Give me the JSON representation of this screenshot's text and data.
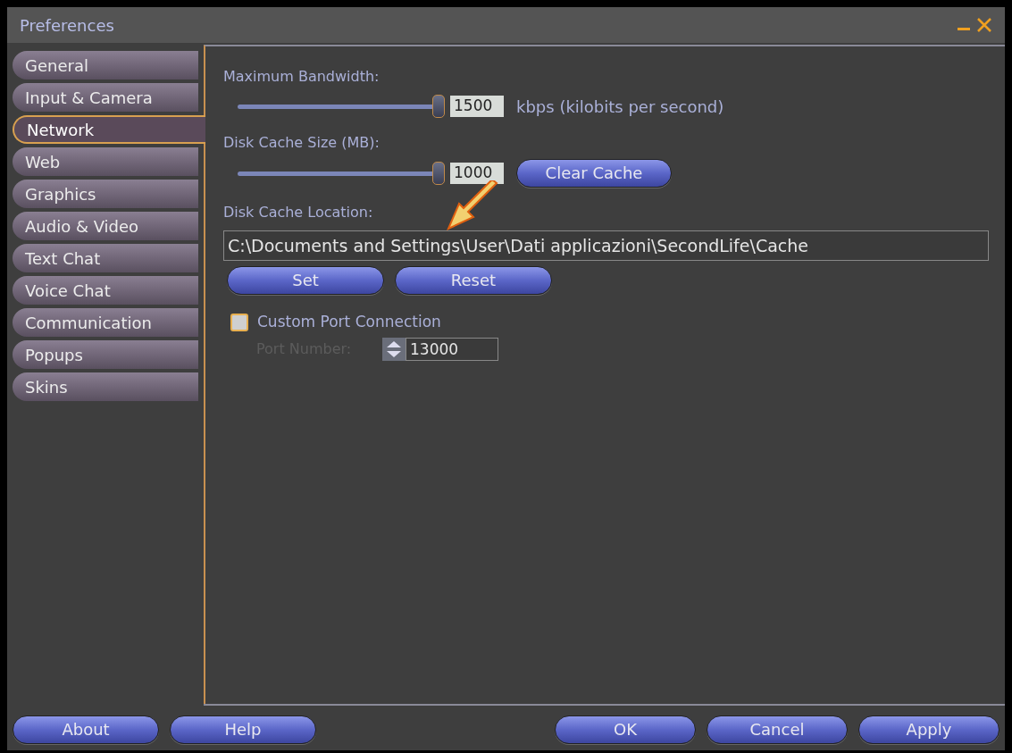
{
  "window": {
    "title": "Preferences"
  },
  "sidebar": {
    "items": [
      {
        "label": "General",
        "selected": false
      },
      {
        "label": "Input & Camera",
        "selected": false
      },
      {
        "label": "Network",
        "selected": true
      },
      {
        "label": "Web",
        "selected": false
      },
      {
        "label": "Graphics",
        "selected": false
      },
      {
        "label": "Audio & Video",
        "selected": false
      },
      {
        "label": "Text Chat",
        "selected": false
      },
      {
        "label": "Voice Chat",
        "selected": false
      },
      {
        "label": "Communication",
        "selected": false
      },
      {
        "label": "Popups",
        "selected": false
      },
      {
        "label": "Skins",
        "selected": false
      }
    ]
  },
  "bandwidth": {
    "label": "Maximum Bandwidth:",
    "level": 1,
    "value": "1500",
    "unit": "kbps (kilobits per second)"
  },
  "disk_cache": {
    "label": "Disk Cache Size (MB):",
    "level": 1,
    "value": "1000",
    "button": "Clear Cache"
  },
  "cache_location": {
    "label": "Disk Cache Location:",
    "value": "C:\\Documents and Settings\\User\\Dati applicazioni\\SecondLife\\Cache",
    "buttons": [
      "Set",
      "Reset"
    ]
  },
  "custom_port": {
    "label": "Custom Port Connection",
    "checked": false
  },
  "port_number": {
    "label": "Port Number:",
    "value": "13000",
    "disabled": true
  },
  "footer": {
    "left_buttons": [
      "About",
      "Help"
    ],
    "right_buttons": [
      "OK",
      "Cancel",
      "Apply"
    ]
  }
}
